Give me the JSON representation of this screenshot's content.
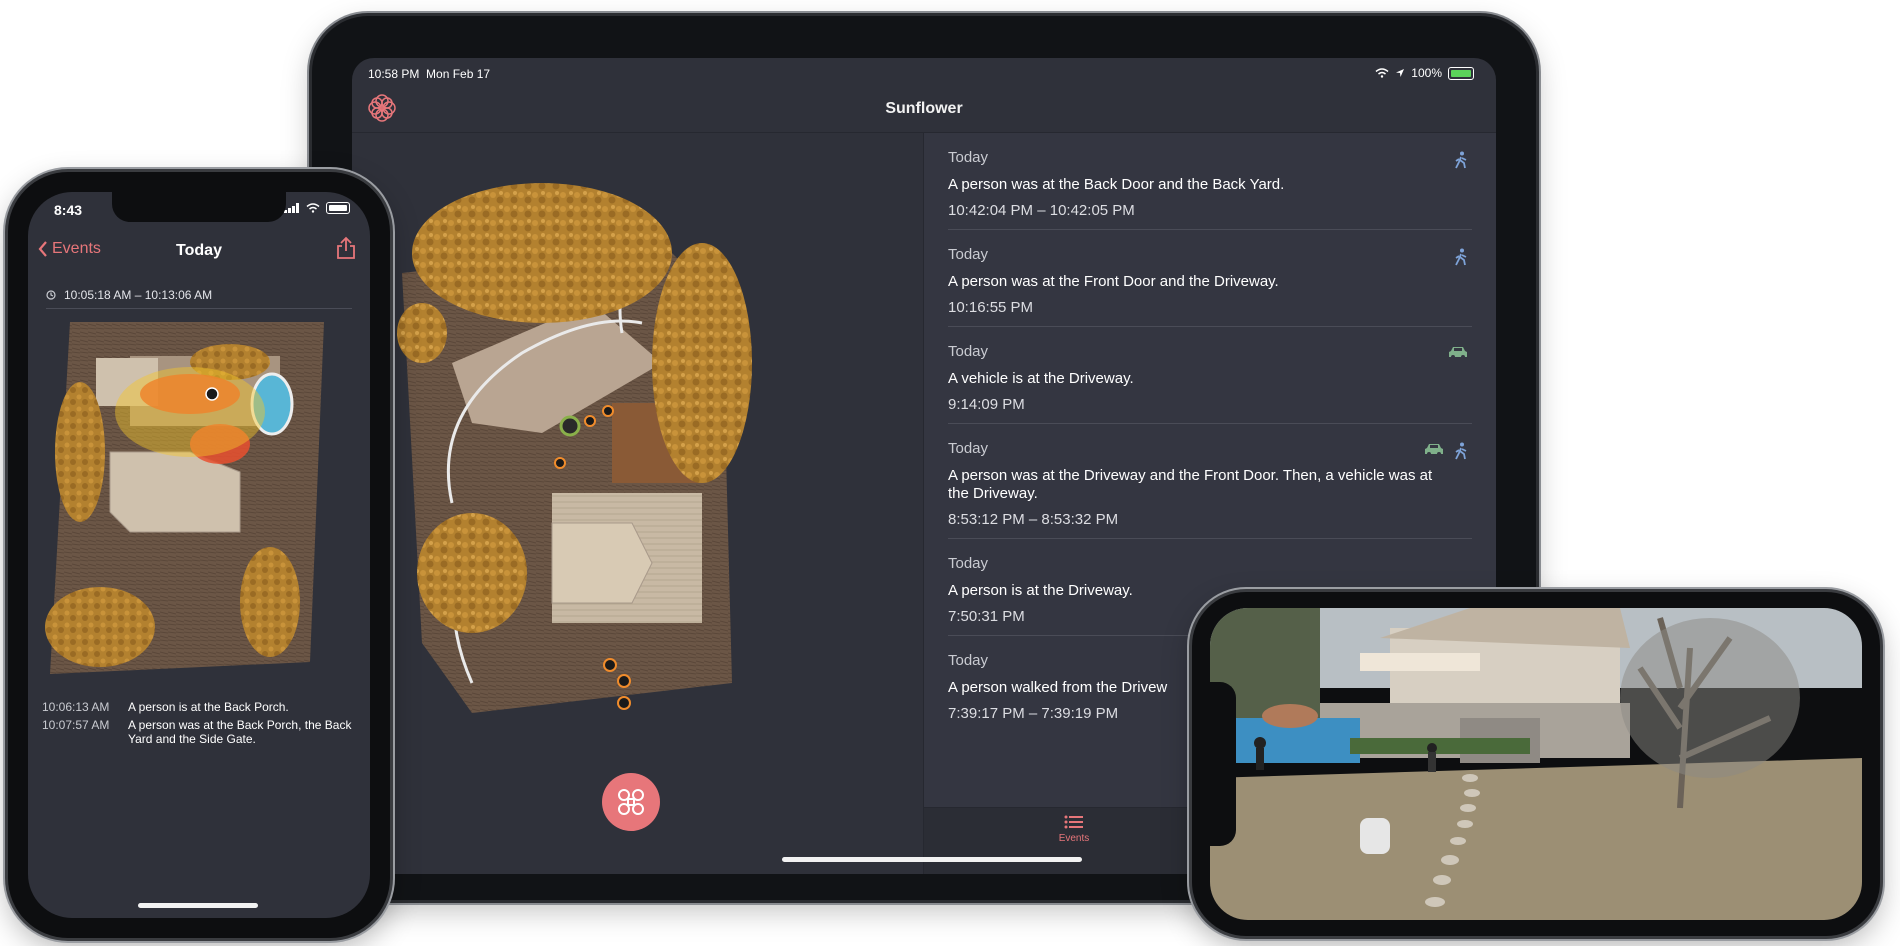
{
  "ipad": {
    "status_time": "10:58 PM",
    "status_date": "Mon Feb 17",
    "battery": "100%",
    "app_title": "Sunflower",
    "events": [
      {
        "day": "Today",
        "description": "A person was at the Back Door and the Back Yard.",
        "time": "10:42:04 PM –  10:42:05 PM",
        "icons": [
          "person-walking"
        ]
      },
      {
        "day": "Today",
        "description": "A person was at the Front Door and the Driveway.",
        "time": "10:16:55 PM",
        "icons": [
          "person-walking"
        ]
      },
      {
        "day": "Today",
        "description": "A vehicle is at the Driveway.",
        "time": "9:14:09 PM",
        "icons": [
          "car"
        ]
      },
      {
        "day": "Today",
        "description": "A person was at the Driveway and the Front Door. Then, a vehicle was at the Driveway.",
        "time": "8:53:12 PM –  8:53:32 PM",
        "icons": [
          "car",
          "person-walking"
        ]
      },
      {
        "day": "Today",
        "description": "A person is at the Driveway.",
        "time": "7:50:31 PM",
        "icons": []
      },
      {
        "day": "Today",
        "description": "A person walked from the Drivew",
        "time": "7:39:17 PM –  7:39:19 PM",
        "icons": []
      }
    ],
    "tab_events_label": "Events",
    "accent": "#e7767a"
  },
  "iphone": {
    "status_time": "8:43",
    "back_label": "Events",
    "title": "Today",
    "time_range": "10:05:18 AM –  10:13:06 AM",
    "log": [
      {
        "time": "10:06:13 AM",
        "text": "A person is at the Back Porch."
      },
      {
        "time": "10:07:57 AM",
        "text": "A person was at the Back Porch, the Back Yard and the Side Gate."
      }
    ]
  }
}
